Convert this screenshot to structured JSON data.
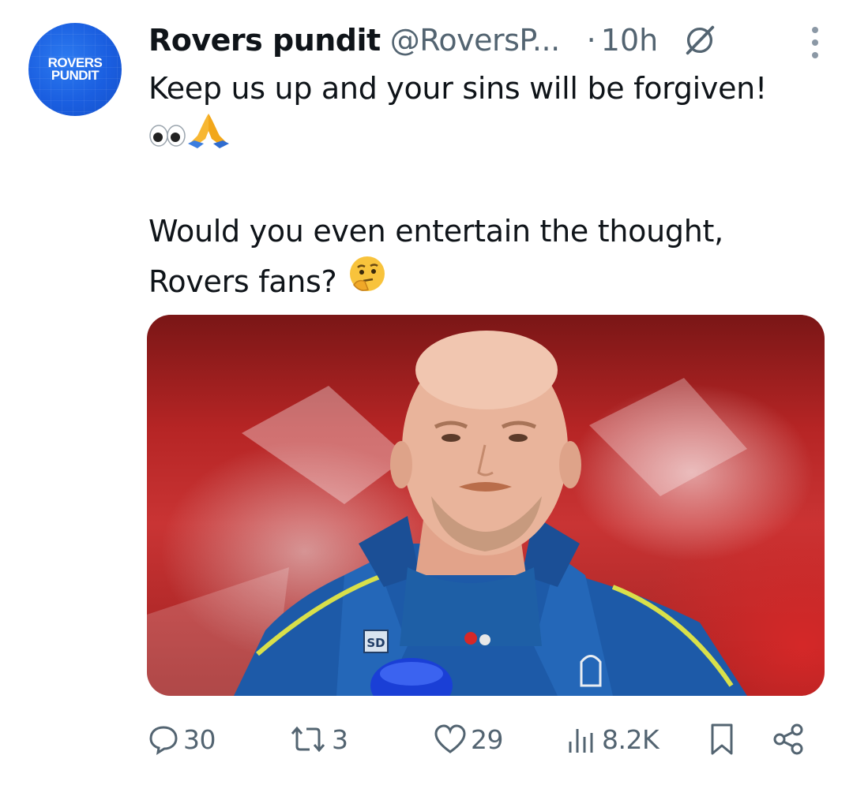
{
  "account": {
    "avatar_text_line1": "ROVERS",
    "avatar_text_line2": "PUNDIT",
    "display_name": "Rovers pundit",
    "handle": "@RoversP...",
    "separator": "·",
    "time": "10h"
  },
  "post": {
    "line1": "Keep us up and your sins will be forgiven!",
    "line2_emoji": "👀🙏",
    "line3": "Would you even entertain the thought,",
    "line4": "Rovers fans?",
    "line4_emoji": "🤔",
    "media_badge_text": "SD"
  },
  "actions": {
    "replies": "30",
    "reposts": "3",
    "likes": "29",
    "views": "8.2K"
  },
  "icons": {
    "grok": "grok-icon",
    "more": "more-vertical-icon",
    "reply": "reply-icon",
    "repost": "repost-icon",
    "like": "heart-icon",
    "views": "views-icon",
    "bookmark": "bookmark-icon",
    "share": "share-icon"
  },
  "colors": {
    "text_primary": "#0f1419",
    "text_secondary": "#536471",
    "avatar_blue": "#1a5ee0"
  }
}
